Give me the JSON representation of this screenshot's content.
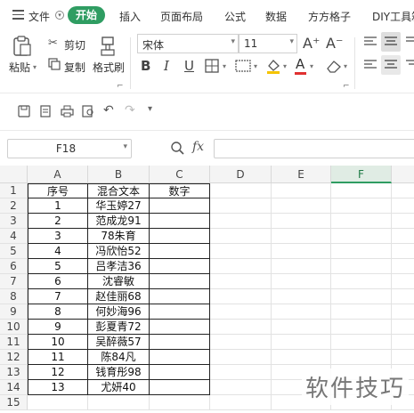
{
  "menubar": {
    "items": [
      "文件",
      "开始",
      "插入",
      "页面布局",
      "公式",
      "数据",
      "方方格子",
      "DIY工具箱"
    ]
  },
  "ribbon": {
    "paste": "粘贴",
    "cut": "剪切",
    "copy": "复制",
    "format_painter": "格式刷",
    "font_name": "宋体",
    "font_size": "11",
    "bold": "B",
    "italic": "I",
    "underline": "U",
    "grow_font": "A⁺",
    "shrink_font": "A⁻",
    "font_color_letter": "A"
  },
  "formula_bar": {
    "name_box": "F18",
    "fx_label": "fx",
    "formula": ""
  },
  "sheet": {
    "columns": [
      "A",
      "B",
      "C",
      "D",
      "E",
      "F"
    ],
    "selected_column": "F",
    "rows": [
      [
        "序号",
        "混合文本",
        "数字"
      ],
      [
        "1",
        "华玉婷27",
        ""
      ],
      [
        "2",
        "范成龙91",
        ""
      ],
      [
        "3",
        "78朱育",
        ""
      ],
      [
        "4",
        "冯欣怡52",
        ""
      ],
      [
        "5",
        "吕孝洁36",
        ""
      ],
      [
        "6",
        "沈睿敏",
        ""
      ],
      [
        "7",
        "赵佳丽68",
        ""
      ],
      [
        "8",
        "何妙海96",
        ""
      ],
      [
        "9",
        "彭夏青72",
        ""
      ],
      [
        "10",
        "吴醉薇57",
        ""
      ],
      [
        "11",
        "陈84凡",
        ""
      ],
      [
        "12",
        "钱育彤98",
        ""
      ],
      [
        "13",
        "尤妍40",
        ""
      ]
    ]
  },
  "watermark": "软件技巧",
  "colors": {
    "accent": "#2f9d62",
    "header_bg": "#f4f4f4",
    "font_color": "#e03030",
    "fill_color": "#f5c400"
  }
}
